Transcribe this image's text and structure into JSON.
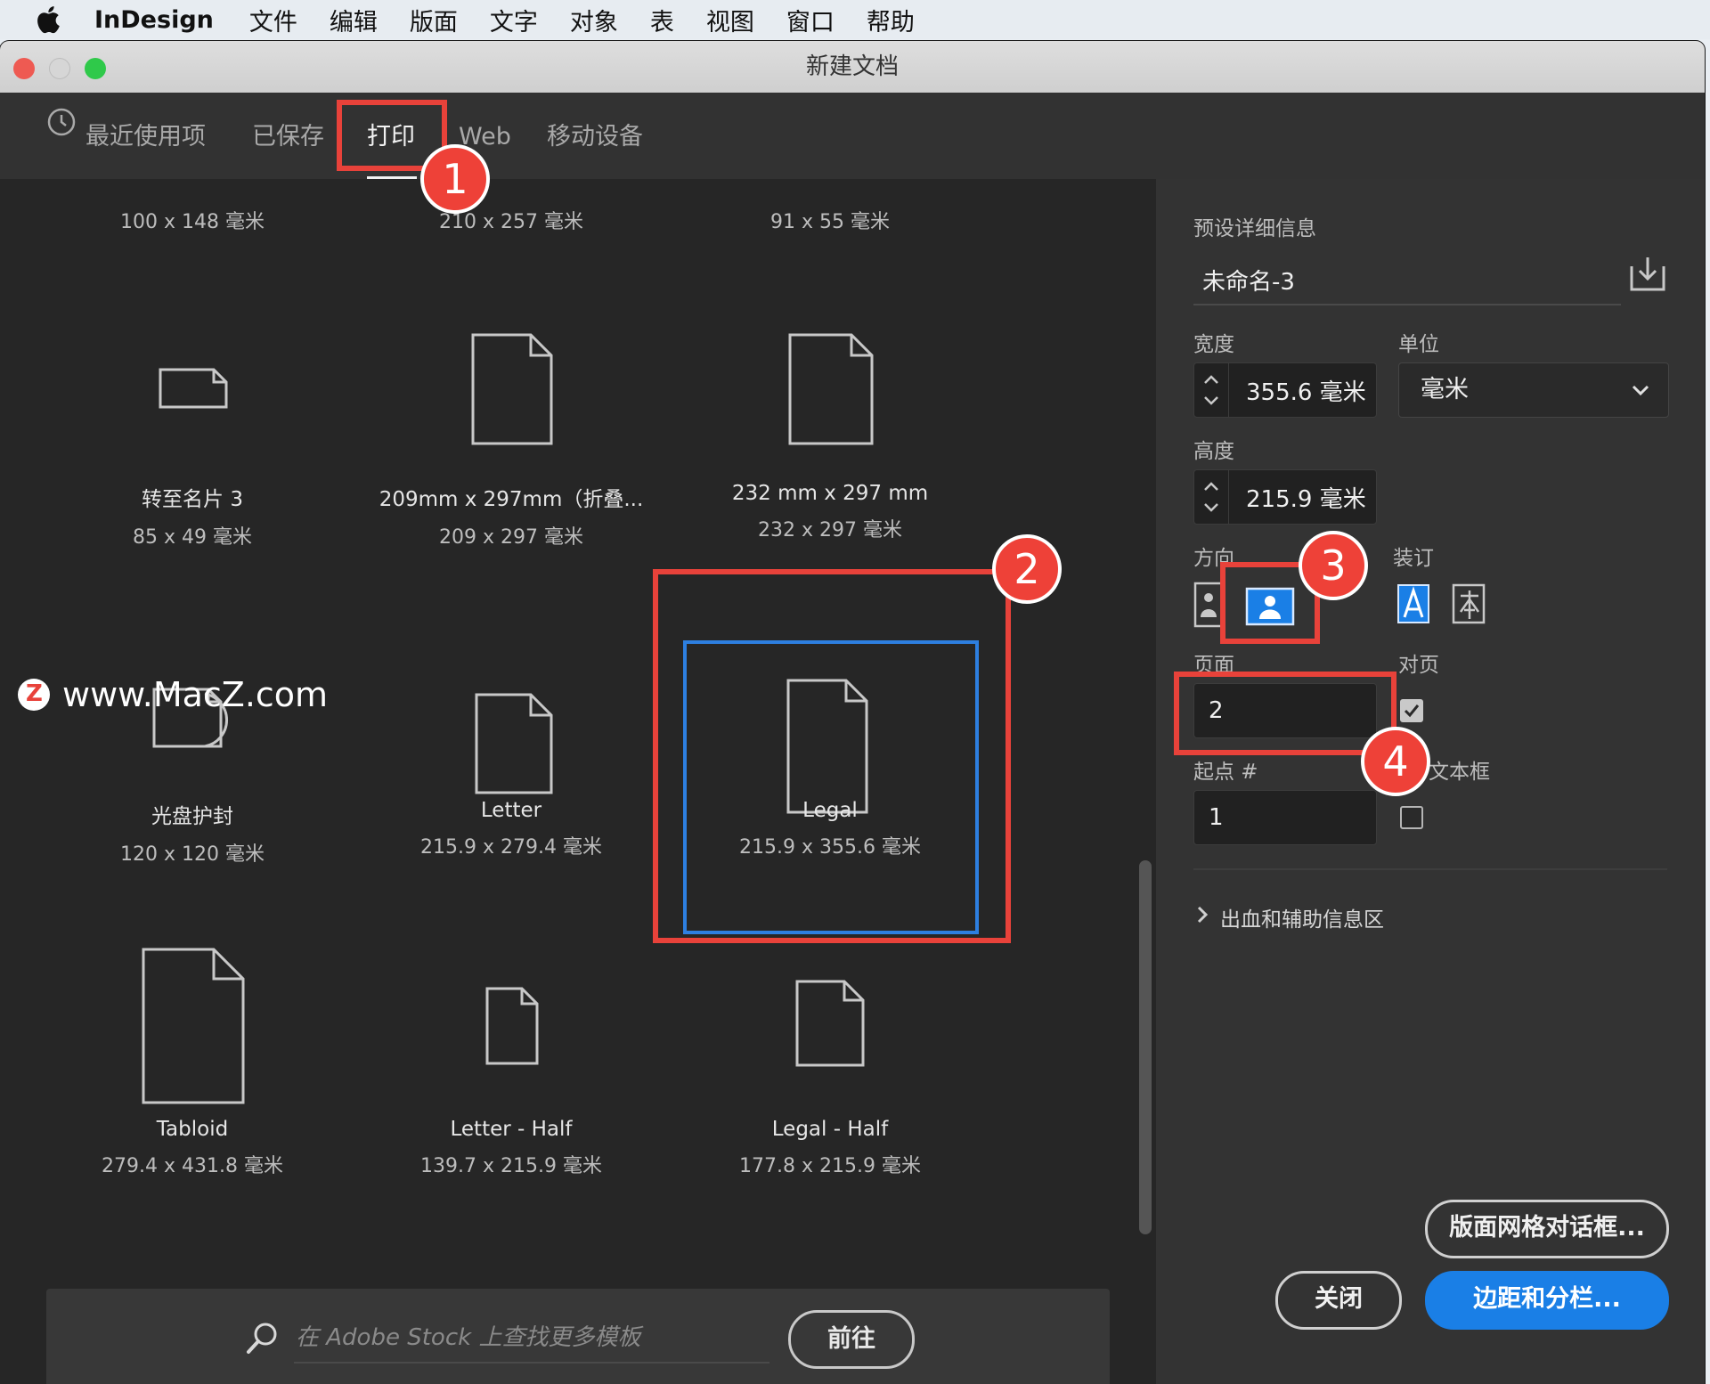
{
  "menubar": {
    "app": "InDesign",
    "items": [
      "文件",
      "编辑",
      "版面",
      "文字",
      "对象",
      "表",
      "视图",
      "窗口",
      "帮助"
    ]
  },
  "window": {
    "title": "新建文档"
  },
  "tabs": {
    "recent": "最近使用项",
    "saved": "已保存",
    "print": "打印",
    "web": "Web",
    "mobile": "移动设备"
  },
  "tiles": {
    "top_sizes": [
      "100 x 148 毫米",
      "210 x 257 毫米",
      "91 x 55 毫米"
    ],
    "row2": [
      {
        "name": "转至名片 3",
        "size": "85 x 49 毫米"
      },
      {
        "name": "209mm x 297mm（折叠...",
        "size": "209 x 297 毫米"
      },
      {
        "name": "232 mm x 297 mm",
        "size": "232 x 297 毫米"
      }
    ],
    "row3": [
      {
        "name": "光盘护封",
        "size": "120 x 120 毫米"
      },
      {
        "name": "Letter",
        "size": "215.9 x 279.4 毫米"
      },
      {
        "name": "Legal",
        "size": "215.9 x 355.6 毫米"
      }
    ],
    "row4": [
      {
        "name": "Tabloid",
        "size": "279.4 x 431.8 毫米"
      },
      {
        "name": "Letter - Half",
        "size": "139.7 x 215.9 毫米"
      },
      {
        "name": "Legal - Half",
        "size": "177.8 x 215.9 毫米"
      }
    ]
  },
  "search": {
    "placeholder": "在 Adobe Stock 上查找更多模板",
    "go_label": "前往"
  },
  "panel": {
    "section_title": "预设详细信息",
    "preset_name": "未命名-3",
    "width_label": "宽度",
    "width_value": "355.6 毫米",
    "unit_label": "单位",
    "unit_value": "毫米",
    "height_label": "高度",
    "height_value": "215.9 毫米",
    "orientation_label": "方向",
    "binding_label": "装订",
    "pages_label": "页面",
    "pages_value": "2",
    "facing_label": "对页",
    "facing_checked": true,
    "start_label": "起点 #",
    "start_value": "1",
    "textframe_label": "文本框",
    "textframe_checked": false,
    "bleed_label": "出血和辅助信息区",
    "layout_grid_button": "版面网格对话框...",
    "close_button": "关闭",
    "margins_button": "边距和分栏..."
  },
  "annotations": [
    "1",
    "2",
    "3",
    "4"
  ],
  "watermark": "www.MacZ.com",
  "colors": {
    "accent_blue": "#1a7fe6",
    "highlight_red": "#e8423a",
    "selection_blue": "#2d7fe0"
  }
}
